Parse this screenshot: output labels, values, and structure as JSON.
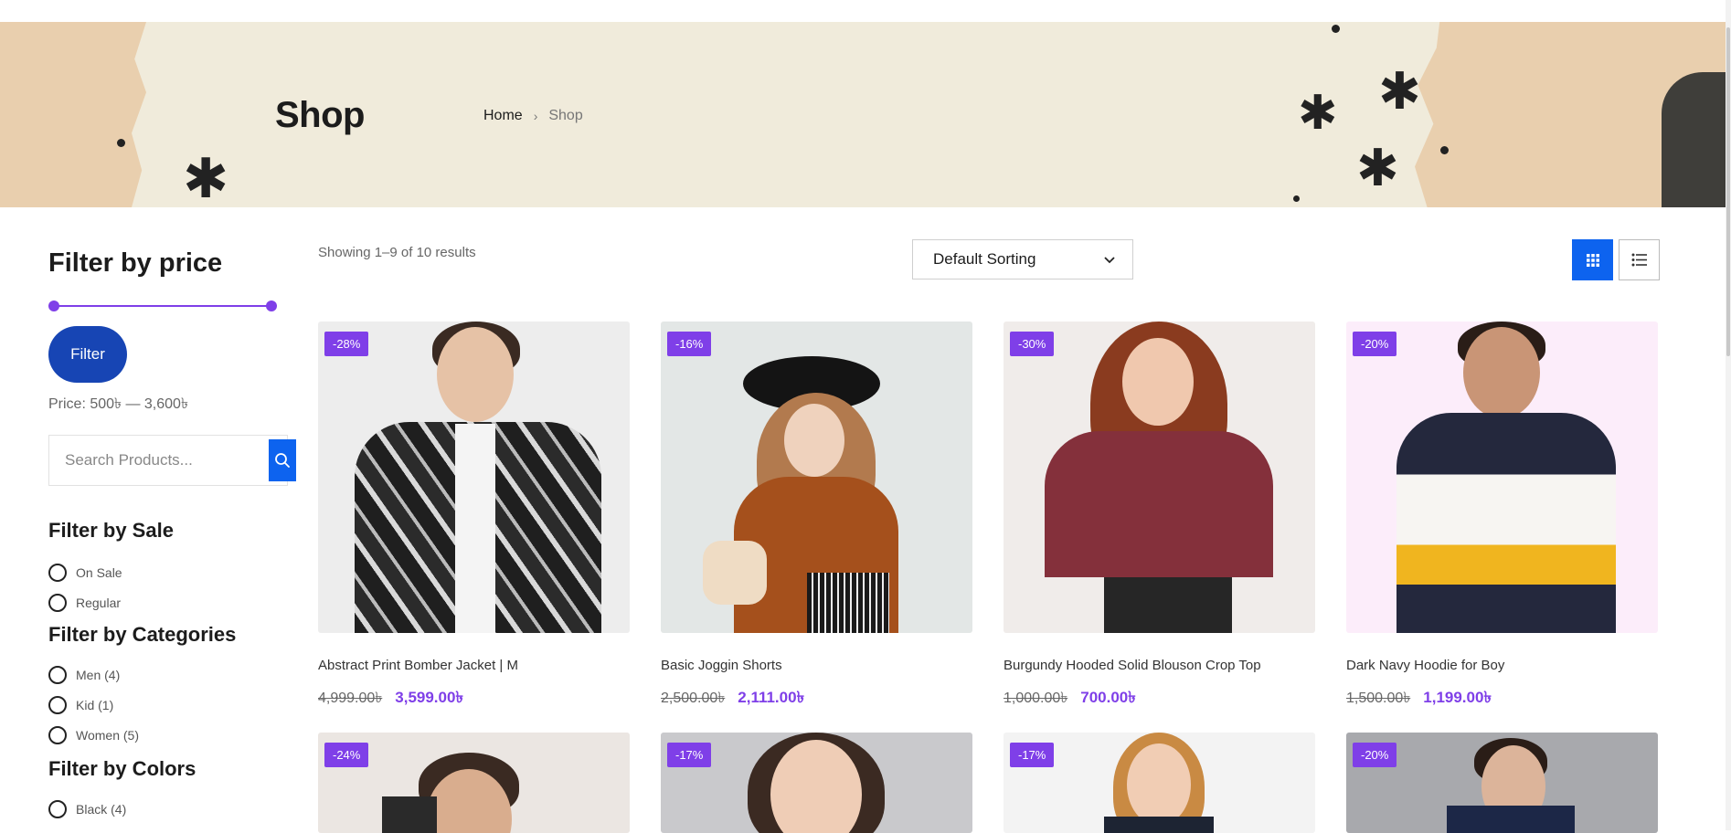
{
  "hero": {
    "title": "Shop",
    "breadcrumb": {
      "home": "Home",
      "separator": "›",
      "current": "Shop"
    }
  },
  "sidebar": {
    "price": {
      "title": "Filter by price",
      "button_label": "Filter",
      "range_label": "Price: 500৳ — 3,600৳"
    },
    "search": {
      "placeholder": "Search Products..."
    },
    "sale": {
      "title": "Filter by Sale",
      "options": [
        "On Sale",
        "Regular"
      ]
    },
    "categories": {
      "title": "Filter by Categories",
      "options": [
        "Men (4)",
        "Kid (1)",
        "Women (5)"
      ]
    },
    "colors": {
      "title": "Filter by Colors",
      "options": [
        "Black (4)"
      ]
    }
  },
  "toolbar": {
    "results_text": "Showing 1–9 of 10 results",
    "sorting": {
      "selected": "Default Sorting"
    }
  },
  "products": [
    {
      "badge": "-28%",
      "name": "Abstract Print Bomber Jacket | M",
      "old_price": "4,999.00৳",
      "new_price": "3,599.00৳"
    },
    {
      "badge": "-16%",
      "name": "Basic Joggin Shorts",
      "old_price": "2,500.00৳",
      "new_price": "2,111.00৳"
    },
    {
      "badge": "-30%",
      "name": "Burgundy Hooded Solid Blouson Crop Top",
      "old_price": "1,000.00৳",
      "new_price": "700.00৳"
    },
    {
      "badge": "-20%",
      "name": "Dark Navy Hoodie for Boy",
      "old_price": "1,500.00৳",
      "new_price": "1,199.00৳"
    },
    {
      "badge": "-24%"
    },
    {
      "badge": "-17%"
    },
    {
      "badge": "-17%"
    },
    {
      "badge": "-20%"
    }
  ],
  "colors": {
    "accent_purple": "#7f3fe8",
    "primary_blue": "#0d63ef",
    "filter_button_blue": "#1745b4"
  }
}
